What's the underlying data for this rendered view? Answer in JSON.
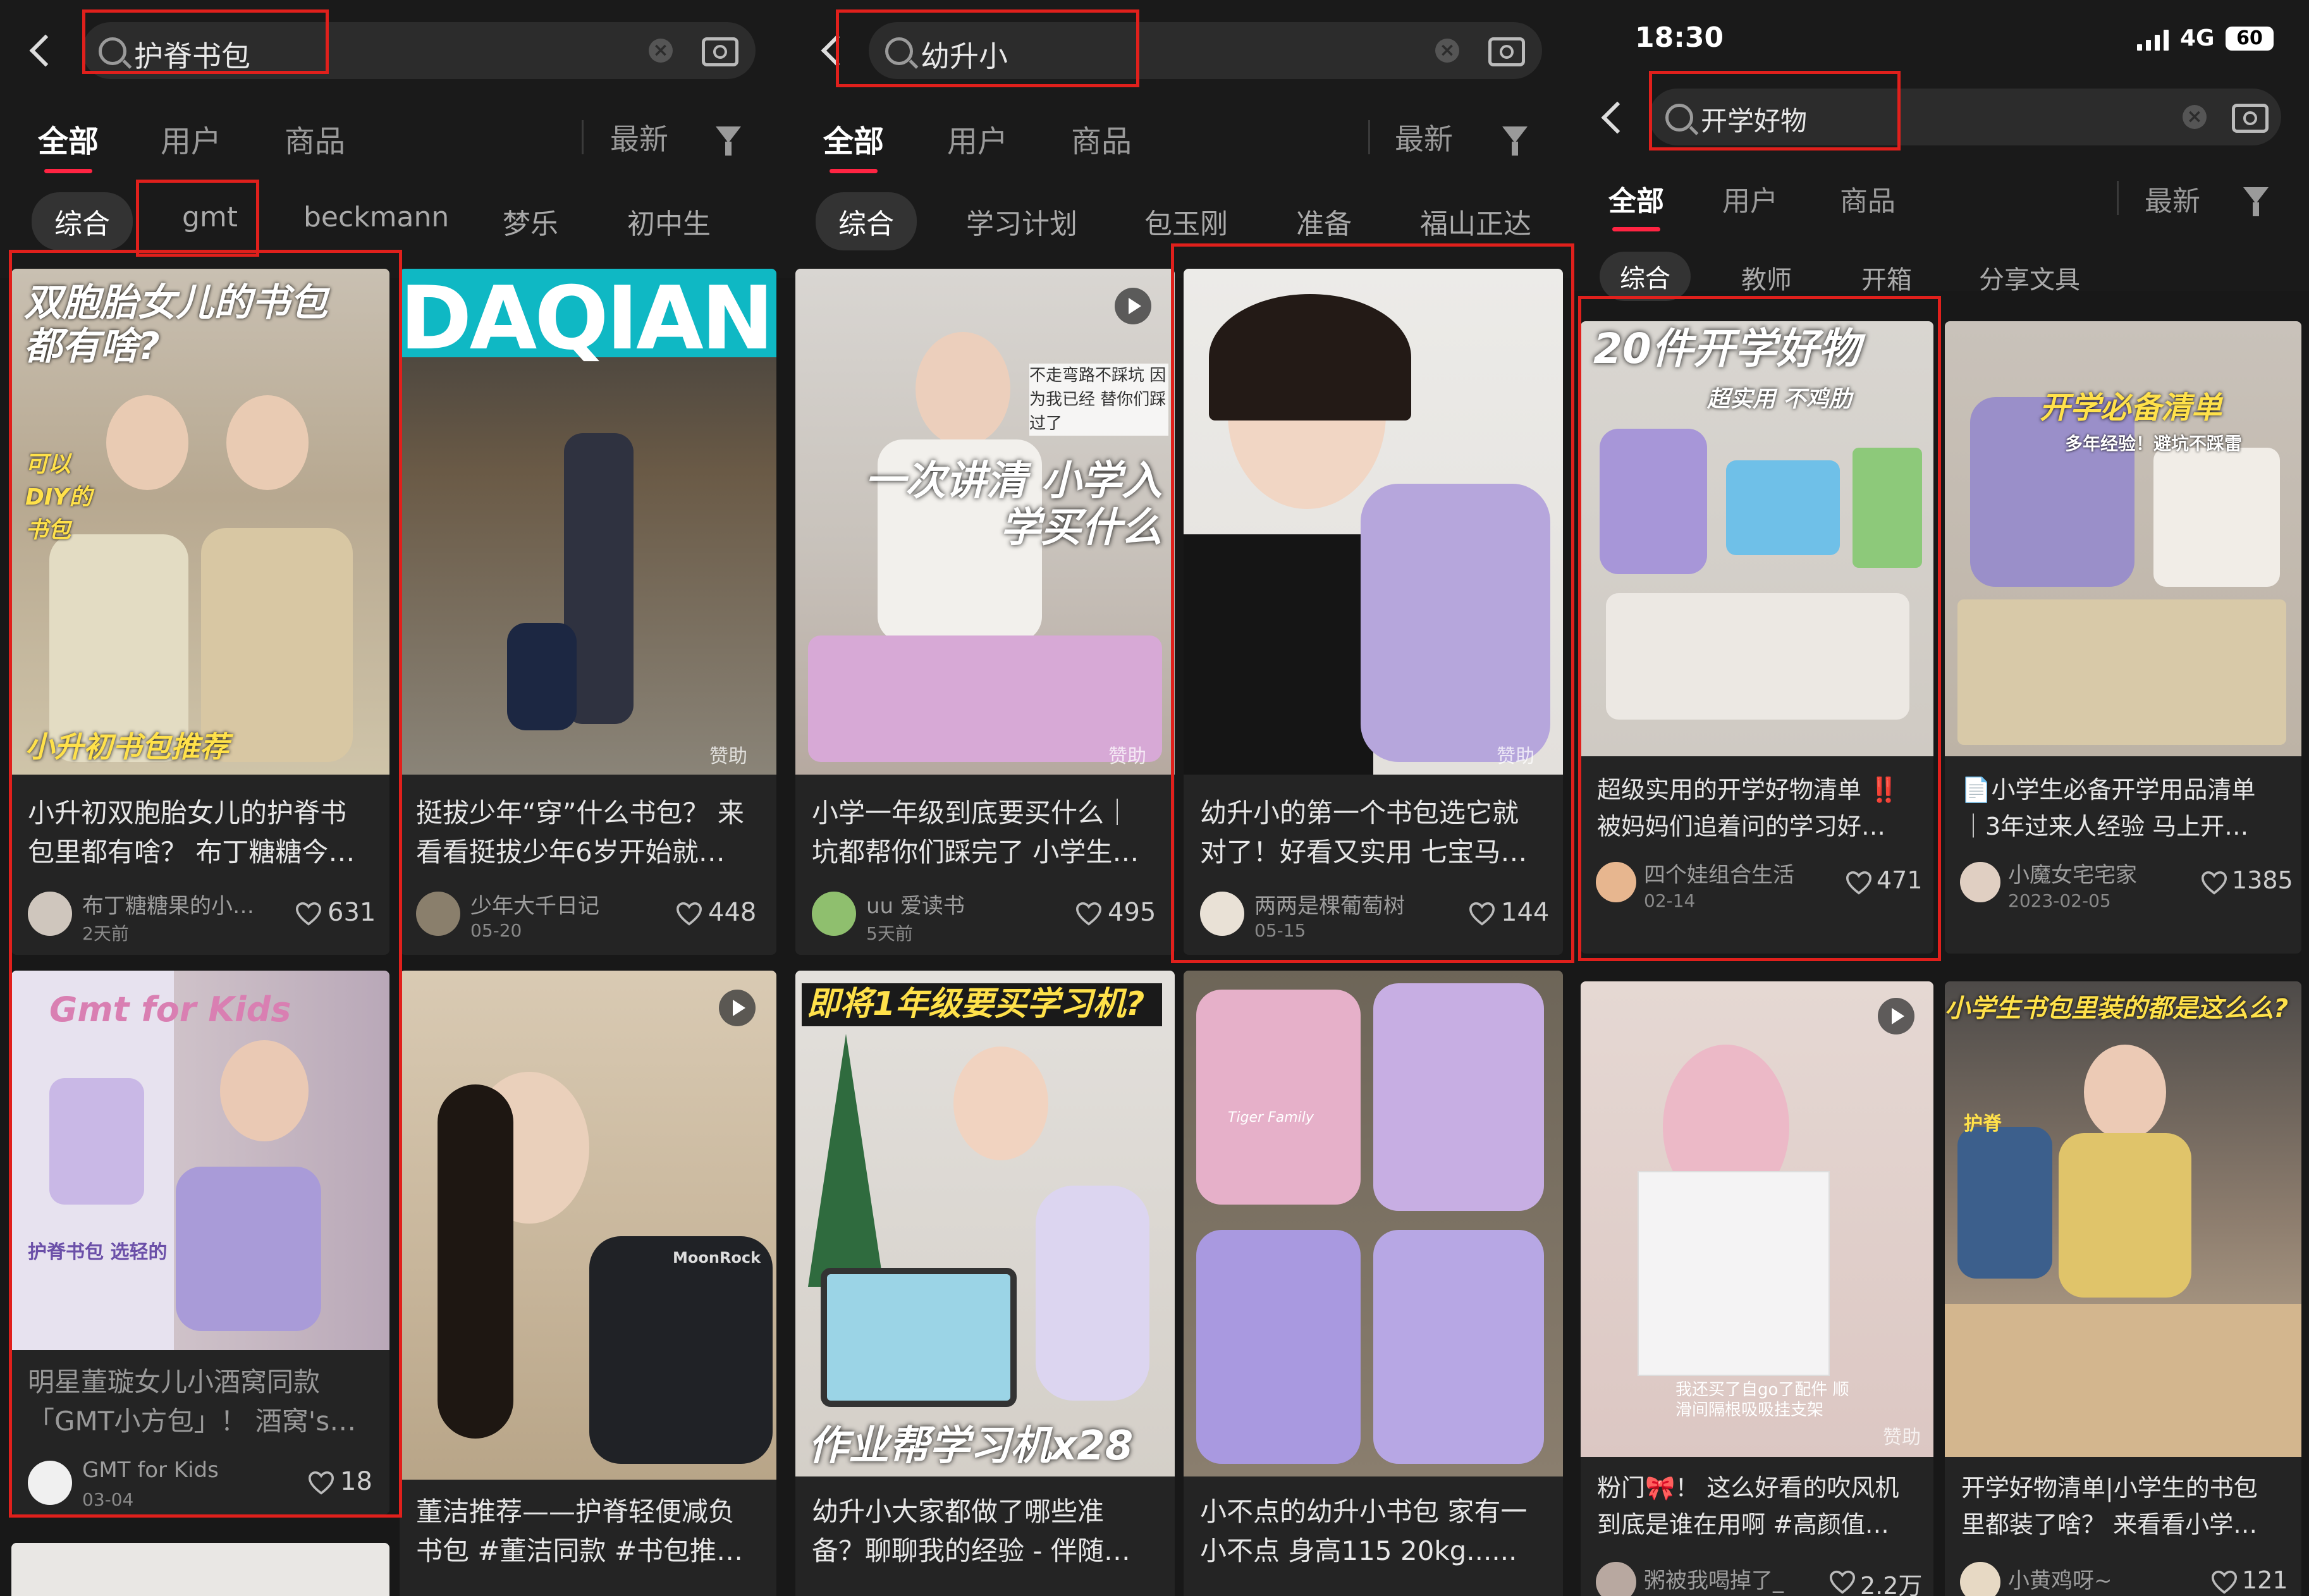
{
  "colors": {
    "accent": "#ff2442",
    "annotation": "#e0201c",
    "bg": "#181818"
  },
  "panels": [
    {
      "query": "护脊书包",
      "tabs": [
        "全部",
        "用户",
        "商品"
      ],
      "sort": "最新",
      "chips": [
        "综合",
        "gmt",
        "beckmann",
        "梦乐",
        "初中生"
      ],
      "cards": [
        {
          "overlay_top": "双胞胎女儿的书包 都有啥?",
          "overlay_side": "可以DIY的书包",
          "overlay_bottom": "小升初书包推荐",
          "title1": "小升初双胞胎女儿的护脊书",
          "title2": "包里都有啥？ 布丁糖糖今…",
          "author": "布丁糖糖果的小…",
          "date": "2天前",
          "likes": "631"
        },
        {
          "overlay_top": "DAQIAN",
          "title1": "挺拔少年“穿”什么书包？ 来",
          "title2": "看看挺拔少年6岁开始就…",
          "author": "少年大千日记",
          "date": "05-20",
          "likes": "448",
          "sponsor": "赞助"
        },
        {
          "overlay_top": "Gmt for Kids",
          "overlay_mid": "护脊书包 选轻的",
          "title1": "明星董璇女儿小酒窝同款",
          "title2": "「GMT小方包」！ 酒窝's…",
          "author": "GMT for Kids",
          "date": "03-04",
          "likes": "18"
        },
        {
          "overlay_top": "MoonRock",
          "title1": "董洁推荐——护脊轻便减负",
          "title2": "书包 #董洁同款 #书包推…"
        }
      ]
    },
    {
      "query": "幼升小",
      "tabs": [
        "全部",
        "用户",
        "商品"
      ],
      "sort": "最新",
      "chips": [
        "综合",
        "学习计划",
        "包玉刚",
        "准备",
        "福山正达"
      ],
      "cards": [
        {
          "overlay_top": "一次讲清 小学入学买什么",
          "overlay_side": "不走弯路不踩坑 因为我已经 替你们踩过了",
          "title1": "小学一年级到底要买什么｜",
          "title2": "坑都帮你们踩完了 小学生…",
          "author": "uu 爱读书",
          "date": "5天前",
          "likes": "495",
          "sponsor": "赞助"
        },
        {
          "title1": "幼升小的第一个书包选它就",
          "title2": "对了！好看又实用 七宝马…",
          "author": "两两是棵葡萄树",
          "date": "05-15",
          "likes": "144",
          "sponsor": "赞助"
        },
        {
          "overlay_top": "即将1年级要买学习机?",
          "overlay_bottom": "作业帮学习机x28",
          "title1": "幼升小大家都做了哪些准",
          "title2": "备？聊聊我的经验 - 伴随…"
        },
        {
          "overlay_top": "Tiger Family",
          "title1": "小不点的幼升小书包 家有一",
          "title2": "小不点 身高115 20kg......"
        }
      ]
    },
    {
      "status_time": "18:30",
      "status_net": "4G",
      "status_battery": "60",
      "query": "开学好物",
      "tabs": [
        "全部",
        "用户",
        "商品"
      ],
      "sort": "最新",
      "chips": [
        "综合",
        "教师",
        "开箱",
        "分享文具"
      ],
      "cards": [
        {
          "overlay_top": "20件开学好物",
          "overlay_sub": "超实用 不鸡肋",
          "title1": "超级实用的开学好物清单 ‼️",
          "title2": "被妈妈们追着问的学习好…",
          "author": "四个娃组合生活",
          "date": "02-14",
          "likes": "471"
        },
        {
          "overlay_top": "开学必备清单",
          "overlay_sub": "多年经验！避坑不踩雷",
          "title1": "📄小学生必备开学用品清单",
          "title2": "｜3年过来人经验 马上开…",
          "author": "小魔女宅宅家",
          "date": "2023-02-05",
          "likes": "1385"
        },
        {
          "overlay_bottom": "我还买了自go了配件 顺滑间隔根吸吸挂支架",
          "title1": "粉门🎀！ 这么好看的吹风机",
          "title2": "到底是谁在用啊 #高颜值…",
          "author": "粥被我喝掉了_",
          "likes": "2.2万",
          "sponsor": "赞助"
        },
        {
          "overlay_top": "小学生书包里装的都是这么么?",
          "overlay_mid": "护脊",
          "title1": "开学好物清单|小学生的书包",
          "title2": "里都装了啥？ 来看看小学…",
          "author": "小黄鸡呀~",
          "likes": "121"
        }
      ]
    }
  ]
}
